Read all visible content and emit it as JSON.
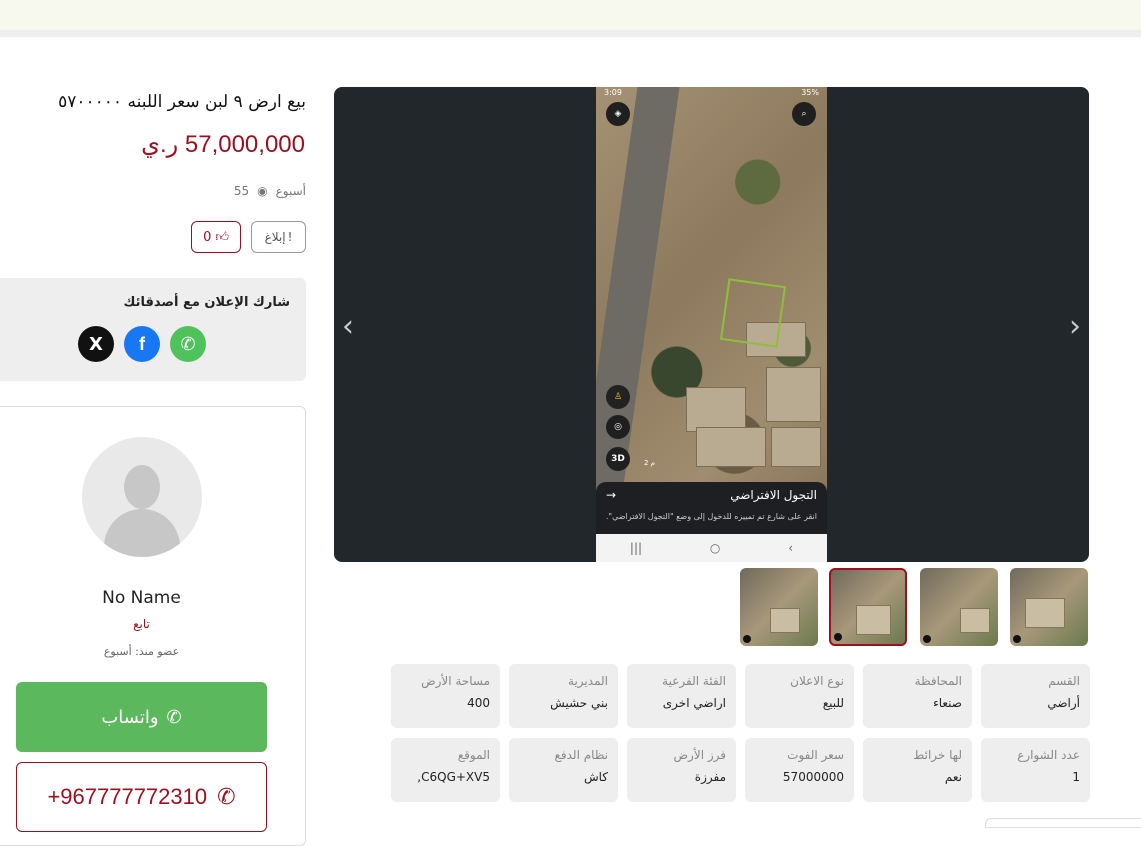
{
  "listing": {
    "title": "بيع ارض ٩ لبن سعر اللبنه ٥٧٠٠٠٠٠",
    "price": "57,000,000 ر.ي",
    "posted": "أسبوع",
    "views": "55",
    "report_label": "إبلاغ",
    "likes": "0"
  },
  "share": {
    "title": "شارك الإعلان مع أصدقائك",
    "x_glyph": "X",
    "facebook_glyph": "f",
    "whatsapp_glyph": "✆"
  },
  "gallery": {
    "phone_status_left": "3:09",
    "phone_status_right": "35%",
    "streetview_title": "التجول الافتراضي",
    "streetview_sub": "انقر على شارع تم تمييزه للدخول إلى وضع \"التجول الافتراضي\".",
    "btn_3d": "3D",
    "scale": "2 م",
    "nav_recent": "|||",
    "nav_home": "○",
    "nav_back": "‹",
    "prev": "‹",
    "next": "›"
  },
  "specs": [
    {
      "label": "القسم",
      "value": "أراضي"
    },
    {
      "label": "المحافظة",
      "value": "صنعاء"
    },
    {
      "label": "نوع الاعلان",
      "value": "للبيع"
    },
    {
      "label": "الفئة الفرعية",
      "value": "اراضي اخرى"
    },
    {
      "label": "المديرية",
      "value": "بني حشيش"
    },
    {
      "label": "مساحة الأرض",
      "value": "400"
    },
    {
      "label": "عدد الشوارع",
      "value": "1"
    },
    {
      "label": "لها خرائط",
      "value": "نعم"
    },
    {
      "label": "سعر الفوت",
      "value": "57000000"
    },
    {
      "label": "فرز الأرض",
      "value": "مفرزة"
    },
    {
      "label": "نظام الدفع",
      "value": "كاش"
    },
    {
      "label": "الموقع",
      "value": "C6QG+XV5,"
    }
  ],
  "seller": {
    "name": "No Name",
    "follow": "تابع",
    "member_since": "عضو منذ: أسبوع",
    "whatsapp_label": "واتساب",
    "phone": "+967777772310"
  },
  "colors": {
    "accent": "#9d0e1e",
    "whatsapp": "#5cb85c",
    "facebook": "#1877f2",
    "x": "#111111",
    "gallery_bg": "#22272c"
  }
}
